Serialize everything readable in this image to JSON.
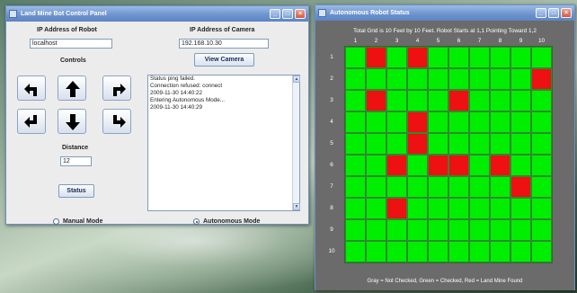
{
  "control_window": {
    "title": "Land Mine Bot Control Panel",
    "robot_ip_label": "IP Address of Robot",
    "robot_ip_value": "localhost",
    "camera_ip_label": "IP Address of Camera",
    "camera_ip_value": "192.168.10.30",
    "view_camera_label": "View Camera",
    "controls_label": "Controls",
    "distance_label": "Distance",
    "distance_value": "12",
    "status_label": "Status",
    "log_lines": [
      "Status ping failed.",
      "Connection refused: connect",
      "2009-11-30 14:40:22",
      "Entering Autonomous Mode...",
      "2009-11-30 14:40:29"
    ],
    "manual_mode_label": "Manual Mode",
    "autonomous_mode_label": "Autonomous Mode",
    "selected_mode": "autonomous",
    "arrow_buttons": [
      "turn-left-icon",
      "forward-icon",
      "turn-right-icon",
      "back-left-icon",
      "backward-icon",
      "back-right-icon"
    ]
  },
  "grid_window": {
    "title": "Autonomous Robot Status",
    "heading": "Total Grid is 10 Feet by 10 Feet.  Robot Starts at 1,1 Pointing Toward 1,2",
    "columns": [
      "1",
      "2",
      "3",
      "4",
      "5",
      "6",
      "7",
      "8",
      "9",
      "10"
    ],
    "rows": [
      "1",
      "2",
      "3",
      "4",
      "5",
      "6",
      "7",
      "8",
      "9",
      "10"
    ],
    "legend": "Gray = Not Checked, Green = Checked, Red = Land Mine Found",
    "colors": {
      "checked": "#00ee00",
      "mine": "#ee1111",
      "not_checked": "#9a9a9a"
    },
    "cells": [
      [
        "G",
        "M",
        "G",
        "M",
        "G",
        "G",
        "G",
        "G",
        "G",
        "G"
      ],
      [
        "G",
        "G",
        "G",
        "G",
        "G",
        "G",
        "G",
        "G",
        "G",
        "M"
      ],
      [
        "G",
        "M",
        "G",
        "G",
        "G",
        "M",
        "G",
        "G",
        "G",
        "G"
      ],
      [
        "G",
        "G",
        "G",
        "M",
        "G",
        "G",
        "G",
        "G",
        "G",
        "G"
      ],
      [
        "G",
        "G",
        "G",
        "M",
        "G",
        "G",
        "G",
        "G",
        "G",
        "G"
      ],
      [
        "G",
        "G",
        "M",
        "G",
        "M",
        "M",
        "G",
        "M",
        "G",
        "G"
      ],
      [
        "G",
        "G",
        "G",
        "G",
        "G",
        "G",
        "G",
        "G",
        "M",
        "G"
      ],
      [
        "G",
        "G",
        "M",
        "G",
        "G",
        "G",
        "G",
        "G",
        "G",
        "G"
      ],
      [
        "G",
        "G",
        "G",
        "G",
        "G",
        "G",
        "G",
        "G",
        "G",
        "G"
      ],
      [
        "G",
        "G",
        "G",
        "G",
        "G",
        "G",
        "G",
        "G",
        "G",
        "G"
      ]
    ]
  }
}
